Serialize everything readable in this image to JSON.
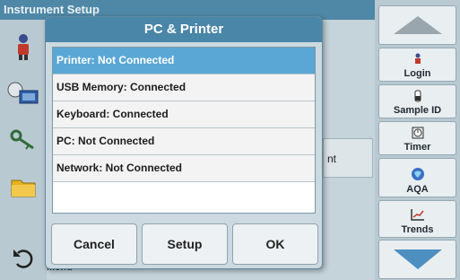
{
  "background": {
    "window_title": "Instrument Setup",
    "row_text": "nt",
    "menu_label": "Menu"
  },
  "dialog": {
    "title": "PC & Printer",
    "items": [
      {
        "label": "Printer: Not Connected",
        "selected": true
      },
      {
        "label": "USB Memory: Connected",
        "selected": false
      },
      {
        "label": "Keyboard: Connected",
        "selected": false
      },
      {
        "label": "PC: Not Connected",
        "selected": false
      },
      {
        "label": "Network: Not Connected",
        "selected": false
      }
    ],
    "buttons": {
      "cancel": "Cancel",
      "setup": "Setup",
      "ok": "OK"
    }
  },
  "sidebar": {
    "items": [
      {
        "label": "Login",
        "icon": "person-icon"
      },
      {
        "label": "Sample ID",
        "icon": "sample-vial-icon"
      },
      {
        "label": "Timer",
        "icon": "timer-icon"
      },
      {
        "label": "AQA",
        "icon": "aqa-globe-icon"
      },
      {
        "label": "Trends",
        "icon": "trends-chart-icon"
      }
    ]
  },
  "colors": {
    "accent": "#4a86a8",
    "selected_row": "#5aa7d6",
    "arrow": "#4d8fc0"
  }
}
